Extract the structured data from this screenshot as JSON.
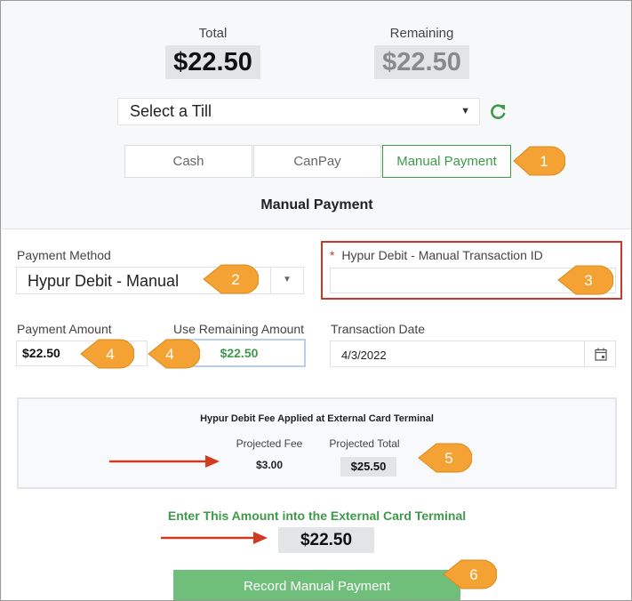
{
  "totals": {
    "total_label": "Total",
    "total_value": "$22.50",
    "remaining_label": "Remaining",
    "remaining_value": "$22.50"
  },
  "till": {
    "selected": "Select a Till",
    "caret": "▼"
  },
  "tabs": [
    {
      "label": "Cash",
      "active": false
    },
    {
      "label": "CanPay",
      "active": false
    },
    {
      "label": "Manual Payment",
      "active": true
    }
  ],
  "section_title": "Manual Payment",
  "payment_method": {
    "label": "Payment Method",
    "value": "Hypur Debit - Manual",
    "caret": "▼"
  },
  "transaction_id": {
    "required_mark": "*",
    "label": "Hypur Debit - Manual Transaction ID",
    "value": ""
  },
  "payment_amount": {
    "label": "Payment Amount",
    "value": "$22.50"
  },
  "use_remaining": {
    "label": "Use Remaining Amount",
    "value": "$22.50"
  },
  "transaction_date": {
    "label": "Transaction Date",
    "value": "4/3/2022"
  },
  "fee_section": {
    "title": "Hypur Debit Fee Applied at External Card Terminal",
    "projected_fee_label": "Projected Fee",
    "projected_fee_value": "$3.00",
    "projected_total_label": "Projected Total",
    "projected_total_value": "$25.50"
  },
  "terminal": {
    "instruction": "Enter This Amount into the External Card Terminal",
    "amount": "$22.50"
  },
  "record_button": "Record Manual Payment",
  "callouts": [
    "1",
    "2",
    "3",
    "4",
    "4",
    "5",
    "6"
  ],
  "colors": {
    "accent_green": "#3e9a4a",
    "callout_orange": "#f4a233",
    "highlight_red": "#c8392b",
    "arrow_red": "#d33a22"
  }
}
